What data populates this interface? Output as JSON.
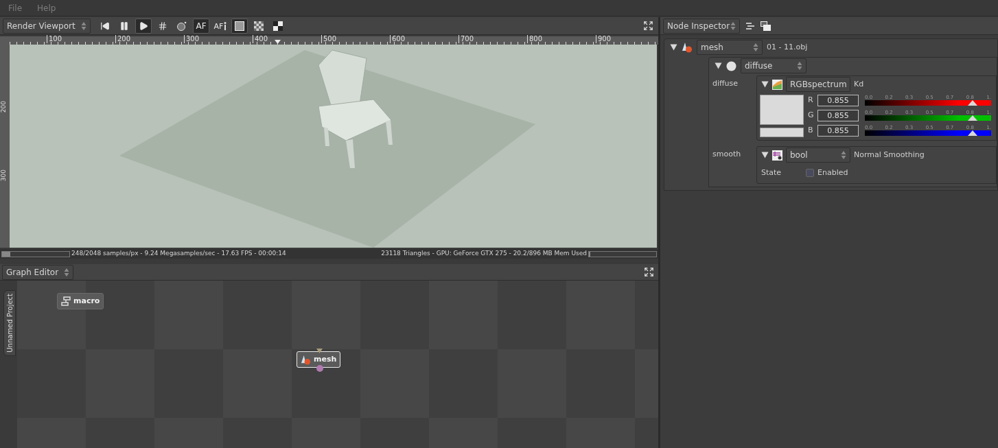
{
  "menu": [
    {
      "label": "File"
    },
    {
      "label": "Help"
    }
  ],
  "viewport": {
    "title": "Render Viewport",
    "toolbar": [
      {
        "kind": "rewind",
        "selected": false
      },
      {
        "kind": "pause",
        "selected": false
      },
      {
        "kind": "play",
        "selected": true
      },
      {
        "kind": "grid",
        "selected": false
      },
      {
        "kind": "sphere",
        "selected": false
      },
      {
        "kind": "text",
        "label": "AF",
        "selected": true
      },
      {
        "kind": "text-info",
        "label": "AF",
        "selected": false
      },
      {
        "kind": "pattern-fine",
        "selected": true
      },
      {
        "kind": "pattern-checker",
        "selected": false
      },
      {
        "kind": "pattern-quad",
        "selected": false
      }
    ],
    "ruler_h": [
      "100",
      "200",
      "300",
      "400",
      "500",
      "600",
      "700",
      "800",
      "900"
    ],
    "ruler_v": [
      "200",
      "300"
    ],
    "status": {
      "left": "248/2048 samples/px - 9.24 Megasamples/sec - 17.63 FPS - 00:00:14",
      "progress": {
        "level": 0.12
      },
      "right": "23118 Triangles - GPU: GeForce GTX 275 - 20.2/896 MB Mem Used",
      "memory": {
        "level": 0.02
      }
    }
  },
  "graph_editor": {
    "title": "Graph Editor",
    "project_tab": "Unnamed Project",
    "nodes": [
      {
        "kind": "macro",
        "label": "macro",
        "selected": false
      },
      {
        "kind": "mesh",
        "label": "mesh",
        "selected": true
      }
    ]
  },
  "inspector": {
    "title": "Node Inspector",
    "node": {
      "type": "mesh",
      "file": "01 - 11.obj",
      "expanded": true,
      "material": {
        "type": "diffuse",
        "expanded": true,
        "params": [
          {
            "kind": "color",
            "label": "diffuse",
            "type": "RGBspectrum",
            "name": "Kd",
            "expanded": true,
            "channels": [
              {
                "label": "R",
                "value": "0.855",
                "level": 0.855,
                "color": "#ff0000",
                "ticks": [
                  "0.0",
                  "0.2",
                  "0.3",
                  "0.5",
                  "0.7",
                  "0.8",
                  "1."
                ]
              },
              {
                "label": "G",
                "value": "0.855",
                "level": 0.855,
                "color": "#00c000",
                "ticks": [
                  "0.0",
                  "0.2",
                  "0.3",
                  "0.5",
                  "0.7",
                  "0.8",
                  "1."
                ]
              },
              {
                "label": "B",
                "value": "0.855",
                "level": 0.855,
                "color": "#0000ff",
                "ticks": [
                  "0.0",
                  "0.2",
                  "0.3",
                  "0.5",
                  "0.7",
                  "0.8",
                  "1."
                ]
              }
            ]
          },
          {
            "kind": "bool",
            "label": "smooth",
            "type": "bool",
            "name": "Normal Smoothing",
            "expanded": true,
            "state_label": "State",
            "option": "Enabled",
            "checked": false
          }
        ]
      }
    }
  }
}
